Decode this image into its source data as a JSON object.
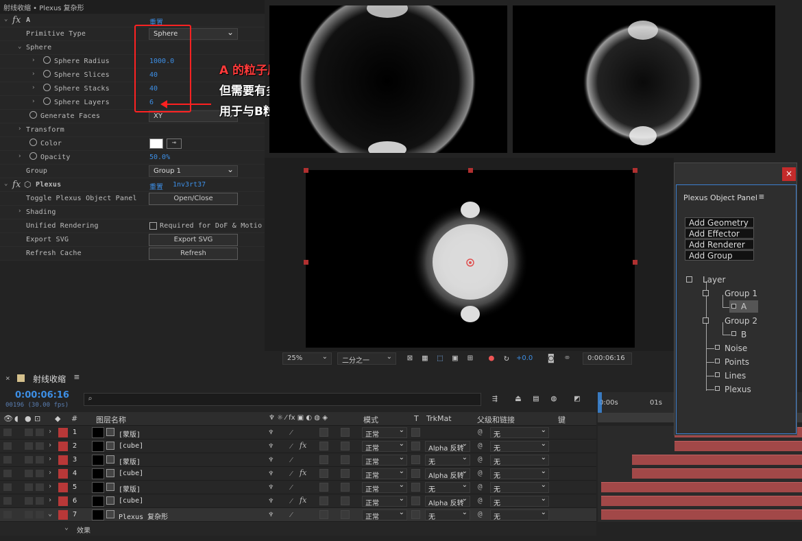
{
  "effects_panel": {
    "title": "射线收缩 • Plexus 复杂形",
    "effect_a": {
      "name": "A",
      "reset": "重置"
    },
    "rows": {
      "primitive_type": {
        "label": "Primitive Type",
        "value": "Sphere"
      },
      "sphere_group": {
        "label": "Sphere"
      },
      "sphere_radius": {
        "label": "Sphere Radius",
        "value": "1000.0"
      },
      "sphere_slices": {
        "label": "Sphere Slices",
        "value": "40"
      },
      "sphere_stacks": {
        "label": "Sphere Stacks",
        "value": "40"
      },
      "sphere_layers": {
        "label": "Sphere Layers",
        "value": "6"
      },
      "generate_faces": {
        "label": "Generate Faces",
        "value": "XY"
      },
      "transform": {
        "label": "Transform"
      },
      "color": {
        "label": "Color"
      },
      "opacity": {
        "label": "Opacity",
        "value": "50.0%"
      },
      "group": {
        "label": "Group",
        "value": "Group 1"
      }
    },
    "plexus": {
      "name": "Plexus",
      "reset": "重置",
      "id": "1nv3rt37"
    },
    "plexus_rows": {
      "toggle_panel": {
        "label": "Toggle Plexus Object Panel",
        "button": "Open/Close"
      },
      "shading": {
        "label": "Shading"
      },
      "unified_rendering": {
        "label": "Unified Rendering",
        "checkbox_label": "Required for DoF & Motio"
      },
      "export_svg": {
        "label": "Export SVG",
        "button": "Export SVG"
      },
      "refresh_cache": {
        "label": "Refresh Cache",
        "button": "Refresh"
      }
    }
  },
  "annotation": {
    "line1": "A 的粒子层保持不动，",
    "line2": "但需要有多个内层",
    "line3": "用于与B粒子层建立线连接"
  },
  "viewer_toolbar": {
    "zoom": "25%",
    "resolution": "二分之一",
    "exposure": "+0.0",
    "timecode": "0:00:06:16"
  },
  "timeline": {
    "comp_name": "射线收缩",
    "timecode": "0:00:06:16",
    "frame_info": "00196 (30.00 fps)",
    "ruler": [
      "0:00s",
      "01s"
    ],
    "columns": {
      "number": "#",
      "layer_name": "图层名称",
      "mode": "模式",
      "t": "T",
      "trkmat": "TrkMat",
      "parent": "父级和链接",
      "keys": "键"
    },
    "layers": [
      {
        "num": "1",
        "name": "[蒙版]",
        "mode": "正常",
        "trkmat": "",
        "parent": "无"
      },
      {
        "num": "2",
        "name": "[cube]",
        "mode": "正常",
        "trkmat": "Alpha 反转",
        "parent": "无"
      },
      {
        "num": "3",
        "name": "[蒙版]",
        "mode": "正常",
        "trkmat": "无",
        "parent": "无"
      },
      {
        "num": "4",
        "name": "[cube]",
        "mode": "正常",
        "trkmat": "Alpha 反转",
        "parent": "无"
      },
      {
        "num": "5",
        "name": "[蒙版]",
        "mode": "正常",
        "trkmat": "无",
        "parent": "无"
      },
      {
        "num": "6",
        "name": "[cube]",
        "mode": "正常",
        "trkmat": "Alpha 反转",
        "parent": "无"
      },
      {
        "num": "7",
        "name": "Plexus 复杂形",
        "mode": "正常",
        "trkmat": "无",
        "parent": "无"
      }
    ],
    "effects_sub": "效果"
  },
  "plexus_object_panel": {
    "title": "Plexus Object Panel",
    "buttons": [
      "Add Geometry",
      "Add Effector",
      "Add Renderer",
      "Add Group"
    ],
    "tree": {
      "root": "Layer",
      "group1": "Group 1",
      "a": "A",
      "group2": "Group 2",
      "b": "B",
      "noise": "Noise",
      "points": "Points",
      "lines": "Lines",
      "plexus": "Plexus"
    }
  },
  "colors": {
    "accent": "#3d8fe6",
    "label_red": "#b83838",
    "annotation_red": "#ff2222",
    "panel_border": "#3c7fd0"
  }
}
